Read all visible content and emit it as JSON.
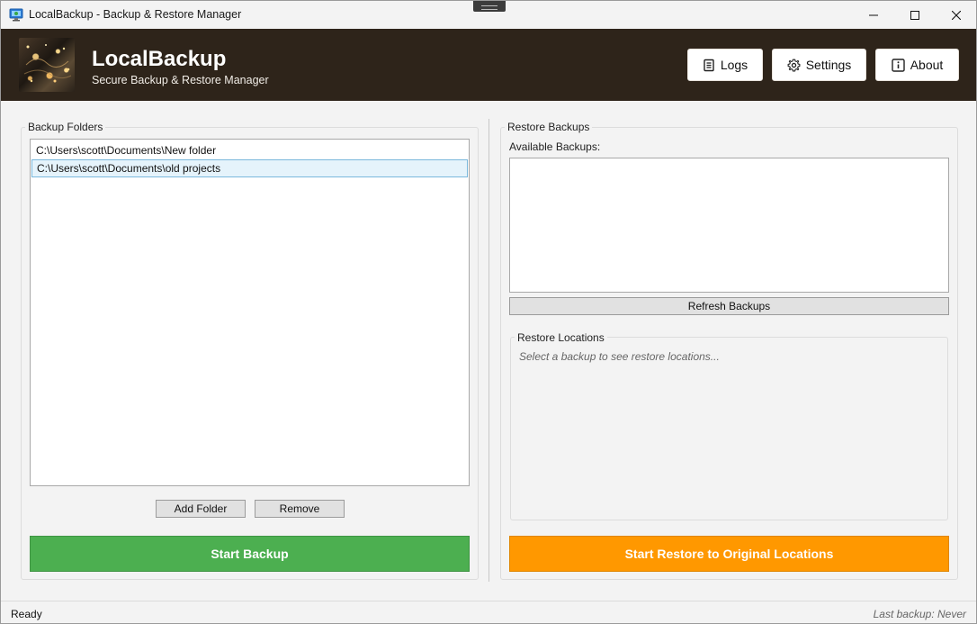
{
  "window": {
    "title": "LocalBackup - Backup & Restore Manager"
  },
  "header": {
    "app_name": "LocalBackup",
    "subtitle": "Secure Backup & Restore Manager",
    "buttons": {
      "logs": "Logs",
      "settings": "Settings",
      "about": "About"
    }
  },
  "backup": {
    "group_label": "Backup Folders",
    "folders": [
      "C:\\Users\\scott\\Documents\\New folder",
      "C:\\Users\\scott\\Documents\\old projects"
    ],
    "selected_index": 1,
    "add_folder_label": "Add Folder",
    "remove_label": "Remove",
    "start_label": "Start Backup"
  },
  "restore": {
    "group_label": "Restore Backups",
    "available_label": "Available Backups:",
    "available_items": [],
    "refresh_label": "Refresh Backups",
    "locations_label": "Restore Locations",
    "locations_placeholder": "Select a backup to see restore locations...",
    "start_label": "Start Restore to Original Locations"
  },
  "status": {
    "left": "Ready",
    "right": "Last backup: Never"
  },
  "colors": {
    "header_bg": "#2e241a",
    "backup_button": "#4caf50",
    "restore_button": "#ff9800",
    "selection_bg": "#e5f3fb",
    "selection_border": "#7ab8dc"
  },
  "icons": {
    "app": "monitor-backup-icon",
    "logs": "document-list-icon",
    "settings": "gear-icon",
    "about": "info-icon"
  }
}
